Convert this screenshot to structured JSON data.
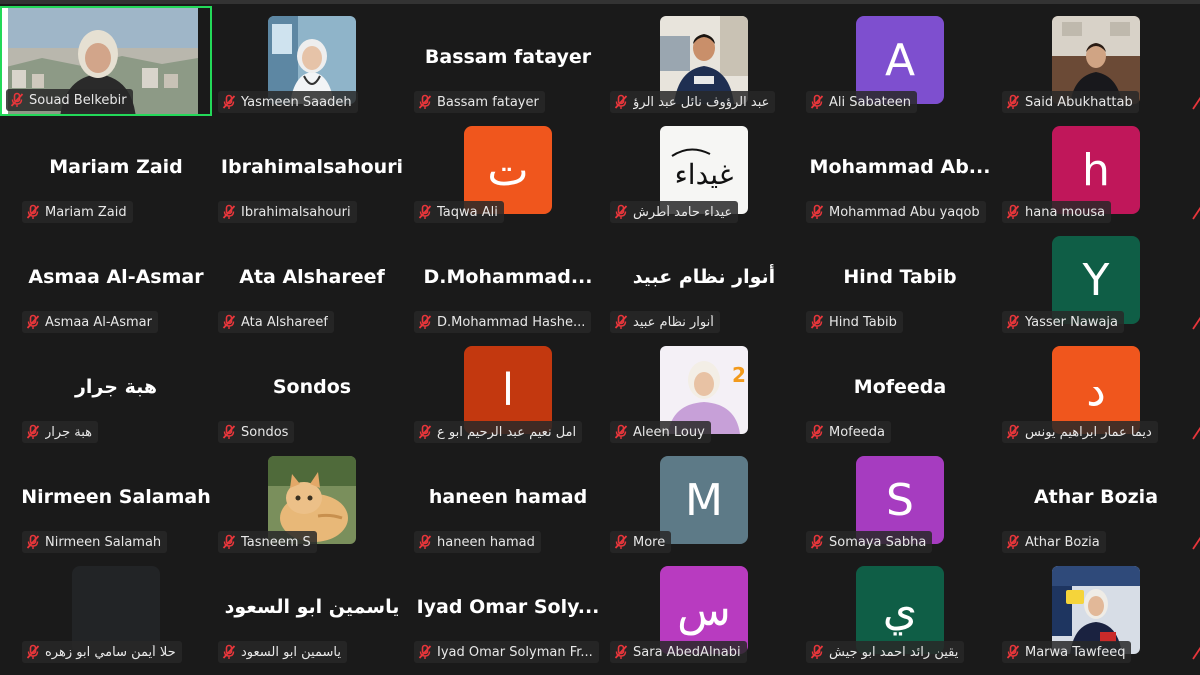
{
  "participants": [
    {
      "name": "Souad Belkebir",
      "display": "video",
      "active": true
    },
    {
      "name": "Yasmeen Saadeh",
      "display": "photo",
      "photo": "doctor-photo"
    },
    {
      "name": "Bassam fatayer",
      "display": "name",
      "big_name": "Bassam fatayer"
    },
    {
      "name": "عبد الرؤوف نائل عبد الرؤ",
      "display": "photo",
      "photo": "man-jacket-photo"
    },
    {
      "name": "Ali Sabateen",
      "display": "initial",
      "initial": "A",
      "color": "#7e4fcf"
    },
    {
      "name": "Said Abukhattab",
      "display": "photo",
      "photo": "man-room-photo"
    },
    {
      "name": "Mariam Zaid",
      "display": "name",
      "big_name": "Mariam Zaid"
    },
    {
      "name": "Ibrahimalsahouri",
      "display": "name",
      "big_name": "Ibrahimalsahouri"
    },
    {
      "name": "Taqwa Ali",
      "display": "initial",
      "initial": "ت",
      "color": "#f0561d"
    },
    {
      "name": "عيداء حامد أطرش",
      "display": "photo",
      "photo": "calligraphy-photo",
      "calligraphy": "غيداء"
    },
    {
      "name": "Mohammad Abu yaqob",
      "display": "name",
      "big_name": "Mohammad  Ab..."
    },
    {
      "name": "hana mousa",
      "display": "initial",
      "initial": "h",
      "color": "#c0175a"
    },
    {
      "name": "Asmaa Al-Asmar",
      "display": "name",
      "big_name": "Asmaa Al-Asmar"
    },
    {
      "name": "Ata Alshareef",
      "display": "name",
      "big_name": "Ata Alshareef"
    },
    {
      "name": "D.Mohammad Hashe...",
      "display": "name",
      "big_name": "D.Mohammad..."
    },
    {
      "name": "أنوار نظام عبيد",
      "display": "name",
      "big_name": "أنوار نظام عبيد"
    },
    {
      "name": "Hind Tabib",
      "display": "name",
      "big_name": "Hind Tabib"
    },
    {
      "name": "Yasser Nawaja",
      "display": "initial",
      "initial": "Y",
      "color": "#0f5e46"
    },
    {
      "name": "هبة جرار",
      "display": "name",
      "big_name": "هبة جرار"
    },
    {
      "name": "Sondos",
      "display": "name",
      "big_name": "Sondos"
    },
    {
      "name": "امل نعيم عبد الرحيم ابو ع",
      "display": "initial",
      "initial": "ا",
      "color": "#c3380f"
    },
    {
      "name": "Aleen Louy",
      "display": "photo",
      "photo": "girl-lilac-photo"
    },
    {
      "name": "Mofeeda",
      "display": "name",
      "big_name": "Mofeeda"
    },
    {
      "name": "ديما عمار ابراهيم يونس",
      "display": "initial",
      "initial": "د",
      "color": "#f0561d"
    },
    {
      "name": "Nirmeen Salamah",
      "display": "name",
      "big_name": "Nirmeen Salamah"
    },
    {
      "name": "Tasneem S",
      "display": "photo",
      "photo": "cat-photo"
    },
    {
      "name": "haneen hamad",
      "display": "name",
      "big_name": "haneen hamad"
    },
    {
      "name": "More",
      "display": "initial",
      "initial": "M",
      "color": "#5d7a87"
    },
    {
      "name": "Somaya Sabha",
      "display": "initial",
      "initial": "S",
      "color": "#a63cc0"
    },
    {
      "name": "Athar Bozia",
      "display": "name",
      "big_name": "Athar Bozia"
    },
    {
      "name": "حلا أيمن سامي ابو زهره",
      "display": "blank"
    },
    {
      "name": "ياسمين ابو السعود",
      "display": "name",
      "big_name": "ياسمين ابو السعود"
    },
    {
      "name": "Iyad Omar Solyman Fr...",
      "display": "name",
      "big_name": "Iyad  Omar  Soly..."
    },
    {
      "name": "Sara AbedAlnabi",
      "display": "initial",
      "initial": "س",
      "color": "#b83bc0"
    },
    {
      "name": "يقين رائد احمد ابو جيش",
      "display": "initial",
      "initial": "ي",
      "color": "#0f5e46"
    },
    {
      "name": "Marwa Tawfeeq",
      "display": "photo",
      "photo": "girl-sign-photo"
    }
  ],
  "colors": {
    "muted_icon": "#e8363b",
    "active_border": "#23d959",
    "background": "#1a1a1a"
  }
}
